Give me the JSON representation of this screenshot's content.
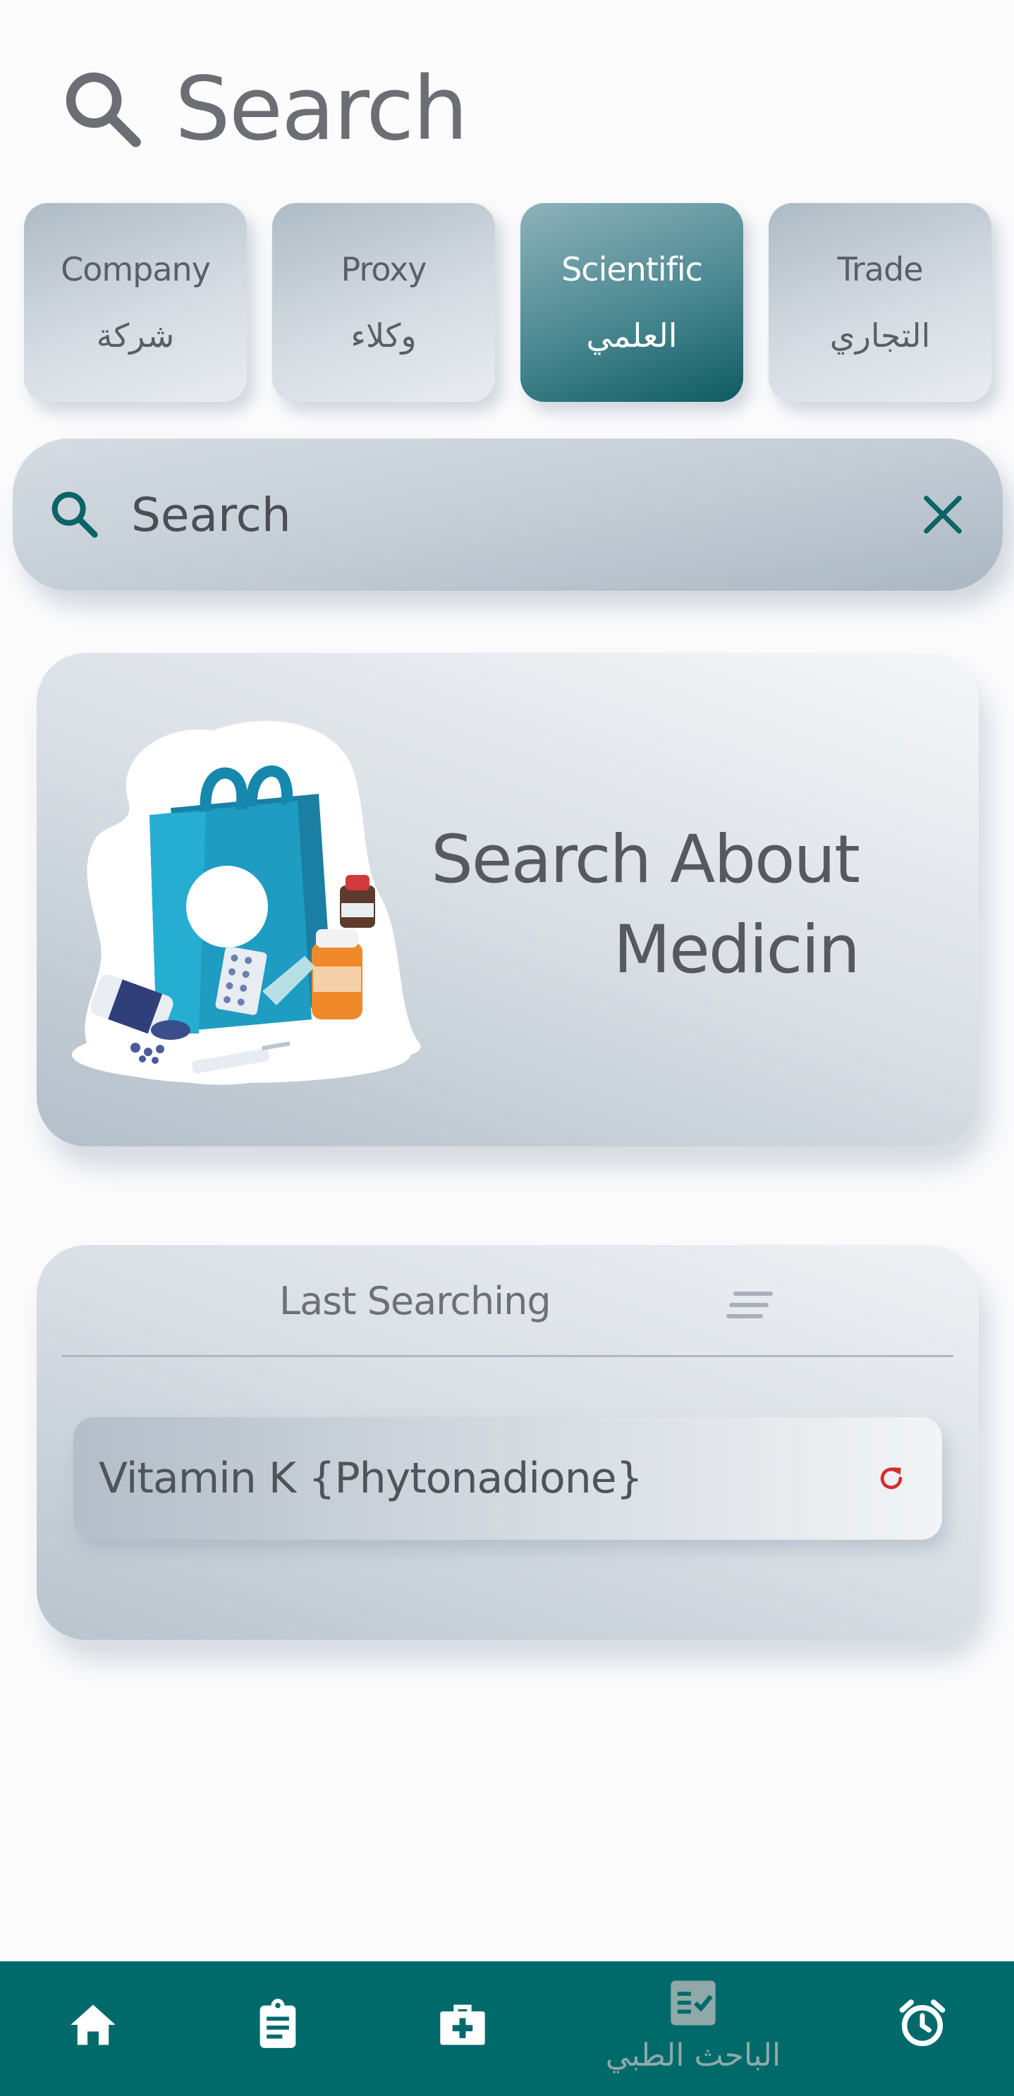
{
  "header": {
    "title": "Search"
  },
  "tabs": [
    {
      "en": "Company",
      "ar": "شركة",
      "active": false
    },
    {
      "en": "Proxy",
      "ar": "وكلاء",
      "active": false
    },
    {
      "en": "Scientific",
      "ar": "العلمي",
      "active": true
    },
    {
      "en": "Trade",
      "ar": "التجاري",
      "active": false
    }
  ],
  "search": {
    "placeholder": "Search"
  },
  "banner": {
    "line1": "Search About",
    "line2": "Medicin"
  },
  "recent": {
    "title": "Last Searching",
    "items": [
      {
        "name": "Vitamin K {Phytonadione}"
      }
    ]
  },
  "bottom_nav": {
    "active_label": "الباحث الطبي"
  },
  "colors": {
    "primary": "#00696a",
    "active_tab_dark": "#0e5b62",
    "reload_red": "#d32f2f"
  }
}
